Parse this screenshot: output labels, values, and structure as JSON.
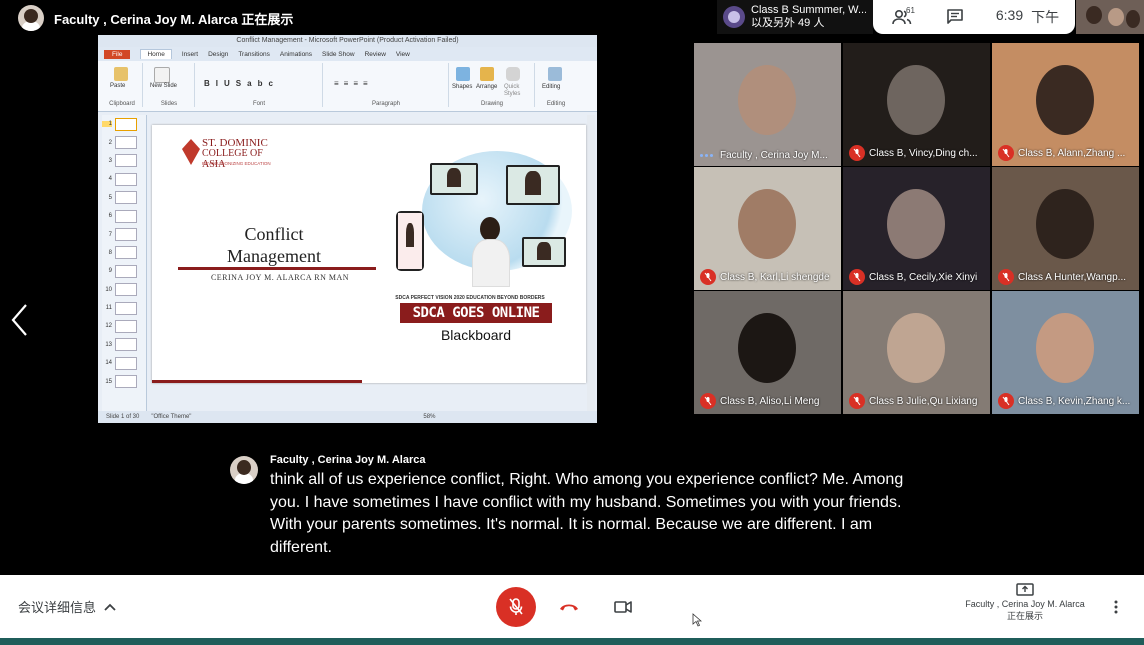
{
  "presenter_bar": {
    "text": "Faculty , Cerina Joy M. Alarca 正在展示"
  },
  "meeting": {
    "title": "Class B Summmer, W...",
    "subtitle": "以及另外 49 人"
  },
  "top_controls": {
    "people_count": "61",
    "time": "6:39",
    "period": "下午"
  },
  "presentation": {
    "window_title": "Conflict Management - Microsoft PowerPoint (Product Activation Failed)",
    "tabs": [
      "File",
      "Home",
      "Insert",
      "Design",
      "Transitions",
      "Animations",
      "Slide Show",
      "Review",
      "View"
    ],
    "groups": [
      "Clipboard",
      "Slides",
      "Font",
      "Paragraph",
      "Drawing",
      "Editing"
    ],
    "buttons": {
      "paste": "Paste",
      "new_slide": "New Slide",
      "shapes": "Shapes",
      "arrange": "Arrange",
      "quick_styles": "Quick Styles",
      "editing": "Editing"
    },
    "slide_numbers": [
      "1",
      "2",
      "3",
      "4",
      "5",
      "6",
      "7",
      "8",
      "9",
      "10",
      "11",
      "12",
      "13",
      "14",
      "15"
    ],
    "status": {
      "slide": "Slide 1 of 30",
      "theme": "\"Office Theme\"",
      "zoom": "58%"
    },
    "slide": {
      "logo_line1": "ST. DOMINIC",
      "logo_line2": "COLLEGE OF ASIA",
      "logo_tagline": "REVOLUTIONIZING EDUCATION",
      "title_line1": "Conflict",
      "title_line2": "Management",
      "subtitle": "CERINA JOY M. ALARCA RN MAN",
      "vision": "SDCA PERFECT VISION 2020 EDUCATION BEYOND BORDERS",
      "banner": "SDCA GOES ONLINE",
      "platform": "Blackboard"
    }
  },
  "participants": [
    {
      "name": "Faculty , Cerina Joy M...",
      "muted": false,
      "bg": "#9b9491",
      "face": "#b08f7c"
    },
    {
      "name": "Class B, Vincy,Ding ch...",
      "muted": true,
      "bg": "#221d1a",
      "face": "#6e655f"
    },
    {
      "name": "Class B, Alann,Zhang ...",
      "muted": true,
      "bg": "#c48d63",
      "face": "#3a2a22"
    },
    {
      "name": "Class B, Karl,Li shengde",
      "muted": true,
      "bg": "#c6c0b6",
      "face": "#a07c66"
    },
    {
      "name": "Class B, Cecily,Xie Xinyi",
      "muted": true,
      "bg": "#27222a",
      "face": "#8c7a74"
    },
    {
      "name": "Class A Hunter,Wangp...",
      "muted": true,
      "bg": "#6a584a",
      "face": "#2e231d"
    },
    {
      "name": "Class B, Aliso,Li Meng",
      "muted": true,
      "bg": "#6f6a66",
      "face": "#1c1714"
    },
    {
      "name": "Class B Julie,Qu Lixiang",
      "muted": true,
      "bg": "#847b74",
      "face": "#bfa592"
    },
    {
      "name": "Class B, Kevin,Zhang k...",
      "muted": true,
      "bg": "#7e8fa0",
      "face": "#c49a82"
    }
  ],
  "caption": {
    "speaker": "Faculty , Cerina Joy M. Alarca",
    "text": "think all of us experience conflict, Right. Who among you experience conflict? Me. Among you. I have sometimes I have conflict with my husband. Sometimes you with your friends. With your parents sometimes. It's normal. It is normal. Because we are different. I am different."
  },
  "bottom_bar": {
    "details_label": "会议详细信息",
    "presenting_name": "Faculty , Cerina Joy M. Alarca",
    "presenting_status": "正在展示"
  },
  "colors": {
    "mute_red": "#d93025",
    "brand_red": "#8a1c1c",
    "teal": "#1f5d5a"
  }
}
